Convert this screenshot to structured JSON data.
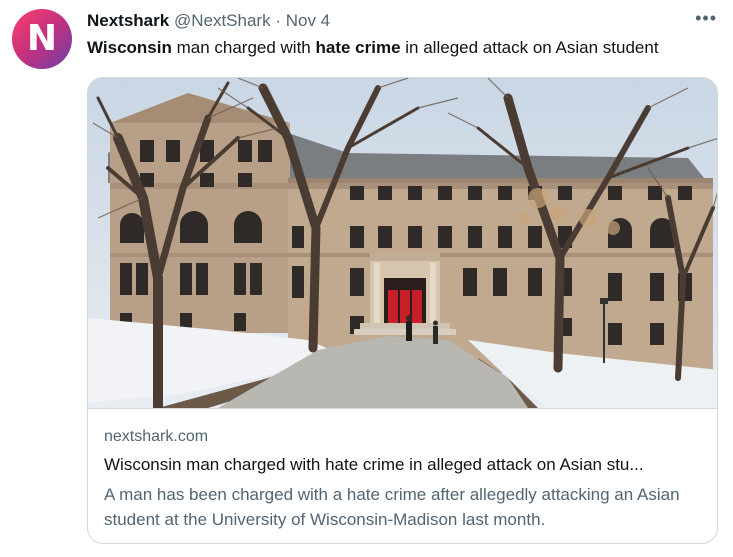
{
  "tweet": {
    "avatar_letter": "N",
    "display_name": "Nextshark",
    "handle": "@NextShark",
    "separator": "·",
    "date": "Nov 4",
    "more_label": "•••",
    "text_parts": [
      "Wisconsin",
      " man charged with ",
      "hate crime",
      " in alleged attack on Asian student"
    ]
  },
  "card": {
    "domain": "nextshark.com",
    "title": "Wisconsin man charged with hate crime in alleged attack on Asian stu...",
    "description": "A man has been charged with a hate crime after allegedly attacking an Asian student at the University of Wisconsin-Madison last month."
  },
  "colors": {
    "text": "#0f1419",
    "muted": "#536471",
    "border": "#cfd9de",
    "brick": "#b59a80",
    "door": "#c8202a"
  }
}
